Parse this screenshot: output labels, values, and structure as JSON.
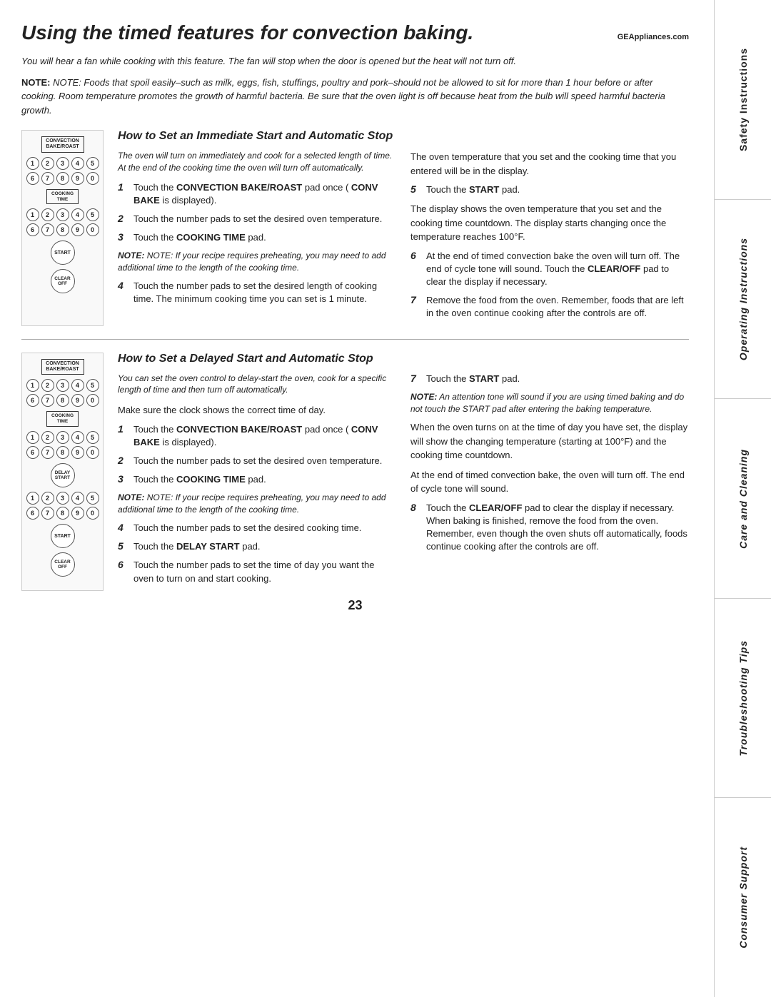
{
  "page": {
    "title": "Using the timed features for convection baking.",
    "ge_url": "GEAppliances.com",
    "intro_italic": "You will hear a fan while cooking with this feature. The fan will stop when the door is opened but the heat will not turn off.",
    "note_text": "NOTE: Foods that spoil easily–such as milk, eggs, fish, stuffings, poultry and pork–should not be allowed to sit for more than 1 hour before or after cooking. Room temperature promotes the growth of harmful bacteria. Be sure that the oven light is off because heat from the bulb will speed harmful bacteria growth.",
    "page_number": "23"
  },
  "section1": {
    "heading": "How to Set an Immediate Start and Automatic Stop",
    "italic_note": "The oven will turn on immediately and cook for a selected length of time. At the end of the cooking time the oven will turn off automatically.",
    "steps_left": [
      {
        "num": "1",
        "text": "Touch the CONVECTION BAKE/ROAST pad once ( CONV BAKE is displayed)."
      },
      {
        "num": "2",
        "text": "Touch the number pads to set the desired oven temperature."
      },
      {
        "num": "3",
        "text": "Touch the COOKING TIME pad."
      }
    ],
    "note_mid": "NOTE: If your recipe requires preheating, you may need to add additional time to the length of the cooking time.",
    "steps_left_cont": [
      {
        "num": "4",
        "text": "Touch the number pads to set the desired length of cooking time. The minimum cooking time you can set is 1 minute."
      }
    ],
    "steps_right": [
      {
        "num": "5",
        "text": "Touch the START pad."
      }
    ],
    "right_text1": "The oven temperature that you set and the cooking time that you entered will be in the display.",
    "right_text2": "The display shows the oven temperature that you set and the cooking time countdown. The display starts changing once the temperature reaches 100°F.",
    "steps_right_cont": [
      {
        "num": "6",
        "text": "At the end of timed convection bake the oven will turn off. The end of cycle tone will sound. Touch the CLEAR/OFF pad to clear the display if necessary."
      },
      {
        "num": "7",
        "text": "Remove the food from the oven. Remember, foods that are left in the oven continue cooking after the controls are off."
      }
    ]
  },
  "section2": {
    "heading": "How to Set a Delayed Start and Automatic Stop",
    "italic_note": "You can set the oven control to delay-start the oven, cook for a specific length of time and then turn off automatically.",
    "intro_text": "Make sure the clock shows the correct time of day.",
    "steps_left": [
      {
        "num": "1",
        "text": "Touch the CONVECTION BAKE/ROAST pad once ( CONV BAKE is displayed)."
      },
      {
        "num": "2",
        "text": "Touch the number pads to set the desired oven temperature."
      },
      {
        "num": "3",
        "text": "Touch the COOKING TIME pad."
      }
    ],
    "note_mid": "NOTE: If your recipe requires preheating, you may need to add additional time to the length of the cooking time.",
    "steps_left_cont": [
      {
        "num": "4",
        "text": "Touch the number pads to set the desired cooking time."
      },
      {
        "num": "5",
        "text": "Touch the DELAY START pad."
      },
      {
        "num": "6",
        "text": "Touch the number pads to set the time of day you want the oven to turn on and start cooking."
      }
    ],
    "steps_right": [
      {
        "num": "7",
        "text": "Touch the START pad."
      }
    ],
    "note_right": "NOTE: An attention tone will sound if you are using timed baking and do not touch the START pad after entering the baking temperature.",
    "right_text1": "When the oven turns on at the time of day you have set, the display will show the changing temperature (starting at 100°F) and the cooking time countdown.",
    "right_text2": "At the end of timed convection bake, the oven will turn off. The end of cycle tone will sound.",
    "steps_right_cont": [
      {
        "num": "8",
        "text": "Touch the CLEAR/OFF pad to clear the display if necessary. When baking is finished, remove the food from the oven. Remember, even though the oven shuts off automatically, foods continue cooking after the controls are off."
      }
    ]
  },
  "panel1": {
    "label": "CONVECTION\nBAKE/ROAST",
    "nums_row1": [
      "1",
      "2",
      "3",
      "4",
      "5"
    ],
    "nums_row2": [
      "6",
      "7",
      "8",
      "9",
      "0"
    ],
    "cooking_label": "COOKING\nTIME",
    "nums2_row1": [
      "1",
      "2",
      "3",
      "4",
      "5"
    ],
    "nums2_row2": [
      "6",
      "7",
      "8",
      "9",
      "0"
    ],
    "start_label": "START",
    "clear_label": "CLEAR\nOFF"
  },
  "panel2": {
    "label": "CONVECTION\nBAKE/ROAST",
    "nums_row1": [
      "1",
      "2",
      "3",
      "4",
      "5"
    ],
    "nums_row2": [
      "6",
      "7",
      "8",
      "9",
      "0"
    ],
    "cooking_label": "COOKING\nTIME",
    "nums2_row1": [
      "1",
      "2",
      "3",
      "4",
      "5"
    ],
    "nums2_row2": [
      "6",
      "7",
      "8",
      "9",
      "0"
    ],
    "delay_label": "DELAY\nSTART",
    "nums3_row1": [
      "1",
      "2",
      "3",
      "4",
      "5"
    ],
    "nums3_row2": [
      "6",
      "7",
      "8",
      "9",
      "0"
    ],
    "start_label": "START",
    "clear_label": "CLEAR\nOFF"
  },
  "sidebar": {
    "items": [
      {
        "label": "Safety Instructions"
      },
      {
        "label": "Operating Instructions"
      },
      {
        "label": "Care and Cleaning"
      },
      {
        "label": "Troubleshooting Tips"
      },
      {
        "label": "Consumer Support"
      }
    ]
  }
}
